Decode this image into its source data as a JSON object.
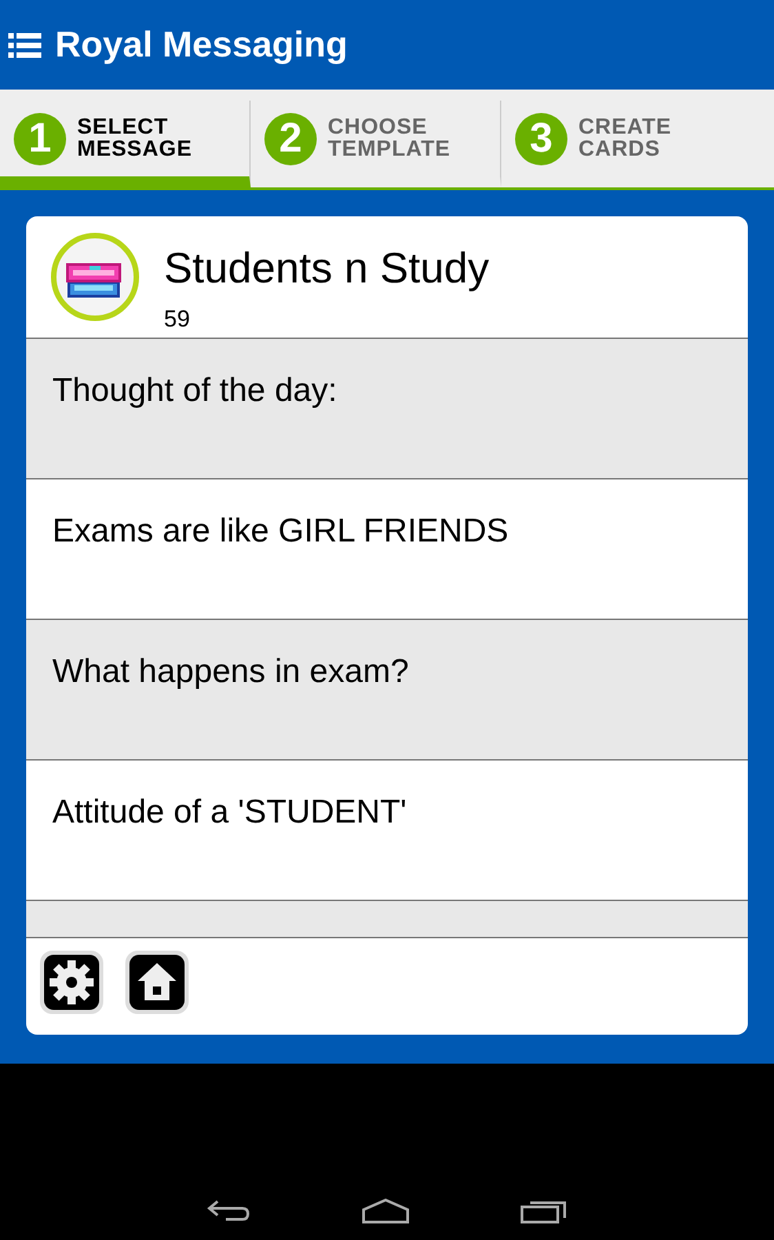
{
  "app_bar": {
    "title": "Royal Messaging"
  },
  "steps": [
    {
      "number": "1",
      "lines": [
        "SELECT",
        "MESSAGE"
      ],
      "selected": true
    },
    {
      "number": "2",
      "lines": [
        "CHOOSE",
        "TEMPLATE"
      ],
      "selected": false
    },
    {
      "number": "3",
      "lines": [
        "CREATE",
        "CARDS"
      ],
      "selected": false
    }
  ],
  "category": {
    "title": "Students n Study",
    "count": "59"
  },
  "messages": [
    {
      "text": "Thought of the day:"
    },
    {
      "text": "Exams are like GIRL FRIENDS"
    },
    {
      "text": "What happens in exam?"
    },
    {
      "text": "Attitude of a 'STUDENT'"
    }
  ]
}
